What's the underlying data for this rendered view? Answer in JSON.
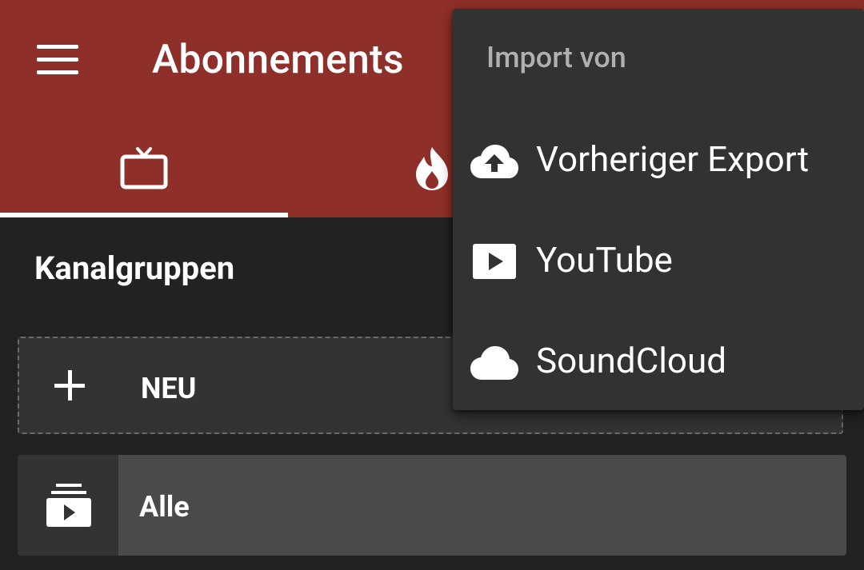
{
  "toolbar": {
    "title": "Abonnements",
    "menu_icon": "hamburger-menu-icon",
    "color": "#8f2f29"
  },
  "tabs": [
    {
      "icon": "tv-icon",
      "selected": true
    },
    {
      "icon": "fire-icon",
      "selected": false
    }
  ],
  "content": {
    "section_title": "Kanalgruppen",
    "new_label": "NEU",
    "groups": [
      {
        "label": "Alle",
        "icon": "subscriptions-icon"
      }
    ]
  },
  "import_menu": {
    "header": "Import von",
    "items": [
      {
        "label": "Vorheriger Export",
        "icon": "cloud-upload-icon"
      },
      {
        "label": "YouTube",
        "icon": "youtube-play-icon"
      },
      {
        "label": "SoundCloud",
        "icon": "cloud-icon"
      }
    ]
  }
}
